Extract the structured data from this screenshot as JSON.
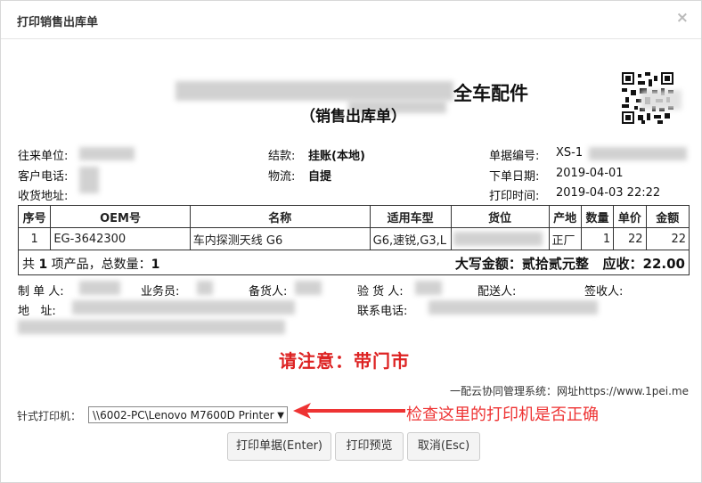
{
  "dialog": {
    "title": "打印销售出库单"
  },
  "doc": {
    "company_suffix": "全车配件",
    "subtitle": "（销售出库单）",
    "fields": {
      "partner_label": "往来单位:",
      "phone_label": "客户电话:",
      "recv_label": "收货地址:",
      "settle_label": "结款:",
      "settle_value": "挂账(本地)",
      "logistics_label": "物流:",
      "logistics_value": "自提",
      "docno_label": "单据编号:",
      "docno_value": "XS-1",
      "orderdate_label": "下单日期:",
      "orderdate_value": "2019-04-01",
      "printtime_label": "打印时间:",
      "printtime_value": "2019-04-03 22:22"
    },
    "table": {
      "headers": [
        "序号",
        "OEM号",
        "名称",
        "适用车型",
        "货位",
        "产地",
        "数量",
        "单价",
        "金额"
      ],
      "rows": [
        [
          "1",
          "EG-3642300",
          "车内探测天线 G6",
          "G6,速锐,G3,L",
          "",
          "正厂",
          "1",
          "22",
          "22"
        ]
      ]
    },
    "summary": {
      "left_pre": "共",
      "count": "1",
      "left_mid": "项产品，总数量：",
      "qty": "1",
      "right": "大写金额：贰拾贰元整   应收：22.00"
    },
    "signatures": {
      "maker": "制 单 人:",
      "sales": "业务员:",
      "picker": "备货人:",
      "checker": "验 货 人:",
      "deliver": "配送人:",
      "receiver": "签收人:",
      "address": "地   址:",
      "contact": "联系电话:"
    },
    "notice": "请注意：带门市"
  },
  "footer": {
    "system": "一配云协同管理系统：网址https://www.1pei.me",
    "printer_label": "针式打印机：",
    "printer_value": "\\\\6002-PC\\Lenovo M7600D Printer",
    "hint": "检查这里的打印机是否正确",
    "buttons": {
      "print": "打印单据(Enter)",
      "preview": "打印预览",
      "cancel": "取消(Esc)"
    }
  },
  "colors": {
    "notice": "#d22222",
    "hint": "#e33333"
  }
}
